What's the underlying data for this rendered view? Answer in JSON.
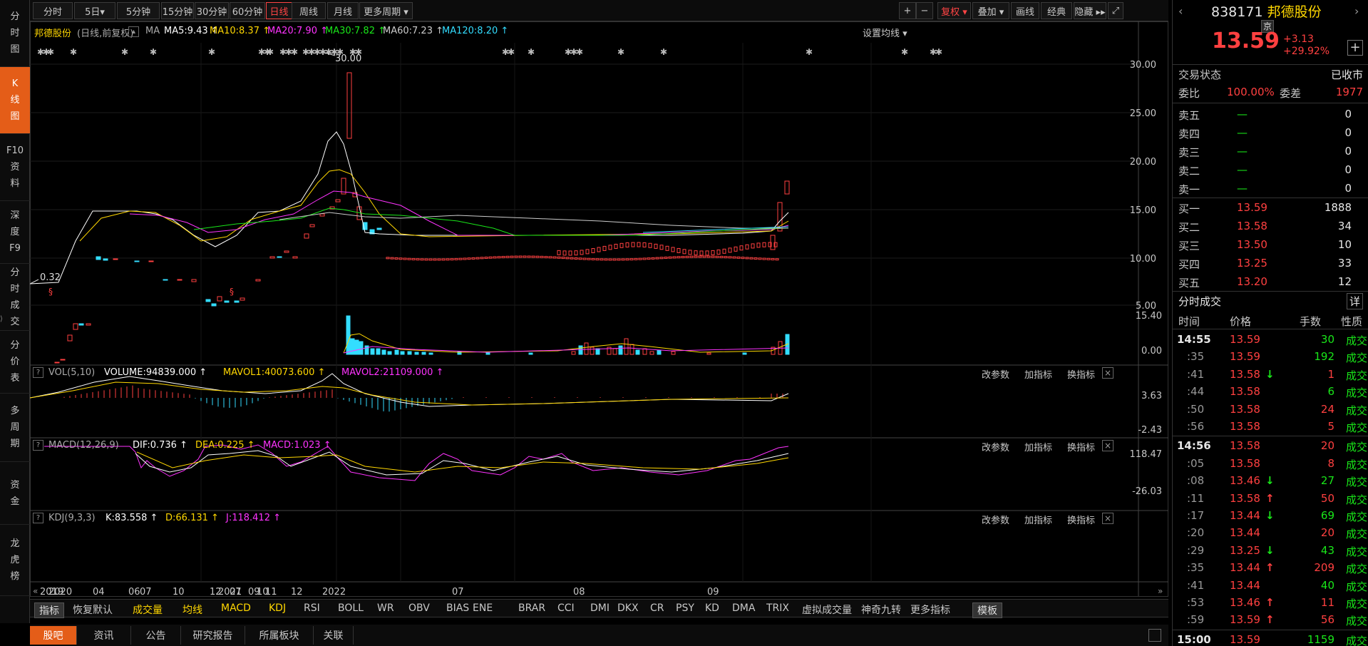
{
  "nav": {
    "items": [
      {
        "label": "分时图",
        "chars": [
          "分",
          "时",
          "图"
        ],
        "active": false
      },
      {
        "label": "K线图",
        "chars": [
          "K",
          "线",
          "图"
        ],
        "active": true
      },
      {
        "label": "F10资料",
        "chars": [
          "F10",
          "资",
          "料"
        ],
        "active": false
      },
      {
        "label": "深度F9",
        "chars": [
          "深",
          "度",
          "F9"
        ],
        "active": false
      },
      {
        "label": "分时成交",
        "chars": [
          "分",
          "时",
          "成",
          "交"
        ],
        "active": false
      },
      {
        "label": "分价表",
        "chars": [
          "分",
          "价",
          "表"
        ],
        "active": false
      },
      {
        "label": "多周期",
        "chars": [
          "多",
          "周",
          "期"
        ],
        "active": false
      },
      {
        "label": "资金",
        "chars": [
          "资",
          "金"
        ],
        "active": false
      },
      {
        "label": "龙虎榜",
        "chars": [
          "龙",
          "虎",
          "榜"
        ],
        "active": false
      }
    ]
  },
  "toolbar": {
    "periods": [
      {
        "label": "分时"
      },
      {
        "label": "5日▾"
      },
      {
        "label": "5分钟"
      },
      {
        "label": "15分钟"
      },
      {
        "label": "30分钟"
      },
      {
        "label": "60分钟"
      },
      {
        "label": "日线",
        "active": true
      },
      {
        "label": "周线"
      },
      {
        "label": "月线"
      },
      {
        "label": "更多周期 ▾"
      }
    ],
    "right": [
      {
        "label": "+"
      },
      {
        "label": "−"
      },
      {
        "label": "复权 ▾",
        "red": true
      },
      {
        "label": "叠加 ▾"
      },
      {
        "label": "画线"
      },
      {
        "label": "经典"
      },
      {
        "label": "隐藏 ▸▸"
      },
      {
        "label": "⤢"
      }
    ]
  },
  "ma_bar": {
    "name": "邦德股份",
    "mode": "(日线,前复权)",
    "ma": "MA",
    "ma5": "MA5:9.43",
    "ma10": "MA10:8.37",
    "ma20": "MA20:7.90",
    "ma30": "MA30:7.82",
    "ma60": "MA60:7.23",
    "ma120": "MA120:8.20",
    "setting": "设置均线 ▾"
  },
  "colors": {
    "up": "#ff4040",
    "down": "#33ddff",
    "ma5": "#ffffff",
    "ma10": "#ffd700",
    "ma20": "#ff33ff",
    "ma30": "#19e619",
    "ma60": "#cccccc",
    "ma120": "#33ddff"
  },
  "main_chart": {
    "yticks": [
      "30.00",
      "25.00",
      "20.00",
      "15.00",
      "10.00",
      "5.00"
    ],
    "high_label": "30.00",
    "low_label": "0.32",
    "arrow": "↑"
  },
  "vol": {
    "q": "?",
    "name": "VOL(5,10)",
    "volume": "VOLUME:94839.000",
    "mavol1": "MAVOL1:40073.600",
    "mavol2": "MAVOL2:21109.000",
    "yticks": [
      "15.40",
      "0.00"
    ]
  },
  "macd": {
    "q": "?",
    "name": "MACD(12,26,9)",
    "dif": "DIF:0.736",
    "dea": "DEA:0.225",
    "macd": "MACD:1.023",
    "yticks": [
      "3.63",
      "-2.43"
    ]
  },
  "kdj": {
    "q": "?",
    "name": "KDJ(9,3,3)",
    "k": "K:83.558",
    "d": "D:66.131",
    "j": "J:118.412",
    "yticks": [
      "118.47",
      "-26.03"
    ]
  },
  "panel_actions": {
    "a": "改参数",
    "b": "加指标",
    "c": "换指标",
    "close": "×"
  },
  "xaxis": {
    "labels": [
      "2019",
      "2020",
      "04",
      "06",
      "07",
      "10",
      "12",
      "2021",
      "07",
      "09",
      "10",
      "11",
      "12",
      "2022",
      "07",
      "08",
      "09"
    ]
  },
  "indicators": {
    "items": [
      "指标",
      "恢复默认",
      "成交量",
      "均线",
      "MACD",
      "KDJ",
      "RSI",
      "BOLL",
      "WR",
      "OBV",
      "BIAS",
      "ENE",
      "BRAR",
      "CCI",
      "DMI",
      "DKX",
      "CR",
      "PSY",
      "KD",
      "DMA",
      "TRIX",
      "虚拟成交量",
      "神奇九转",
      "更多指标",
      "模板"
    ]
  },
  "bottom_tabs": {
    "items": [
      "股吧",
      "资讯",
      "公告",
      "研究报告",
      "所属板块",
      "关联"
    ]
  },
  "stock": {
    "code": "838171",
    "name": "邦德股份",
    "exchange": "京",
    "price": "13.59",
    "change": "+3.13",
    "pct": "+29.92%",
    "add": "+"
  },
  "quote": {
    "status_label": "交易状态",
    "status": "已收市",
    "wb_label": "委比",
    "wb": "100.00%",
    "wc_label": "委差",
    "wc": "1977"
  },
  "asks": [
    {
      "label": "卖五",
      "price": "—",
      "vol": "0"
    },
    {
      "label": "卖四",
      "price": "—",
      "vol": "0"
    },
    {
      "label": "卖三",
      "price": "—",
      "vol": "0"
    },
    {
      "label": "卖二",
      "price": "—",
      "vol": "0"
    },
    {
      "label": "卖一",
      "price": "—",
      "vol": "0"
    }
  ],
  "bids": [
    {
      "label": "买一",
      "price": "13.59",
      "vol": "1888"
    },
    {
      "label": "买二",
      "price": "13.58",
      "vol": "34"
    },
    {
      "label": "买三",
      "price": "13.50",
      "vol": "10"
    },
    {
      "label": "买四",
      "price": "13.25",
      "vol": "33"
    },
    {
      "label": "买五",
      "price": "13.20",
      "vol": "12"
    }
  ],
  "trades": {
    "title": "分时成交",
    "detail": "详",
    "headers": [
      "时间",
      "价格",
      "手数",
      "性质"
    ],
    "rows": [
      {
        "t": "14:55",
        "p": "13.59",
        "a": "",
        "v": "30",
        "k": "成交",
        "vc": "grn"
      },
      {
        "t": ":35",
        "p": "13.59",
        "a": "",
        "v": "192",
        "k": "成交",
        "vc": "grn"
      },
      {
        "t": ":41",
        "p": "13.58",
        "a": "↓",
        "v": "1",
        "k": "成交",
        "vc": "red"
      },
      {
        "t": ":44",
        "p": "13.58",
        "a": "",
        "v": "6",
        "k": "成交",
        "vc": "grn"
      },
      {
        "t": ":50",
        "p": "13.58",
        "a": "",
        "v": "24",
        "k": "成交",
        "vc": "red"
      },
      {
        "t": ":56",
        "p": "13.58",
        "a": "",
        "v": "5",
        "k": "成交",
        "vc": "red"
      },
      {
        "t": "14:56",
        "p": "13.58",
        "a": "",
        "v": "20",
        "k": "成交",
        "vc": "red"
      },
      {
        "t": ":05",
        "p": "13.58",
        "a": "",
        "v": "8",
        "k": "成交",
        "vc": "red"
      },
      {
        "t": ":08",
        "p": "13.46",
        "a": "↓",
        "v": "27",
        "k": "成交",
        "vc": "grn"
      },
      {
        "t": ":11",
        "p": "13.58",
        "a": "↑",
        "v": "50",
        "k": "成交",
        "vc": "red"
      },
      {
        "t": ":17",
        "p": "13.44",
        "a": "↓",
        "v": "69",
        "k": "成交",
        "vc": "grn"
      },
      {
        "t": ":20",
        "p": "13.44",
        "a": "",
        "v": "20",
        "k": "成交",
        "vc": "red"
      },
      {
        "t": ":29",
        "p": "13.25",
        "a": "↓",
        "v": "43",
        "k": "成交",
        "vc": "grn"
      },
      {
        "t": ":35",
        "p": "13.44",
        "a": "↑",
        "v": "209",
        "k": "成交",
        "vc": "red"
      },
      {
        "t": ":41",
        "p": "13.44",
        "a": "",
        "v": "40",
        "k": "成交",
        "vc": "grn"
      },
      {
        "t": ":53",
        "p": "13.46",
        "a": "↑",
        "v": "11",
        "k": "成交",
        "vc": "red"
      },
      {
        "t": ":59",
        "p": "13.59",
        "a": "↑",
        "v": "56",
        "k": "成交",
        "vc": "red"
      },
      {
        "t": "15:00",
        "p": "13.59",
        "a": "",
        "v": "1159",
        "k": "成交",
        "vc": "grn"
      }
    ]
  }
}
